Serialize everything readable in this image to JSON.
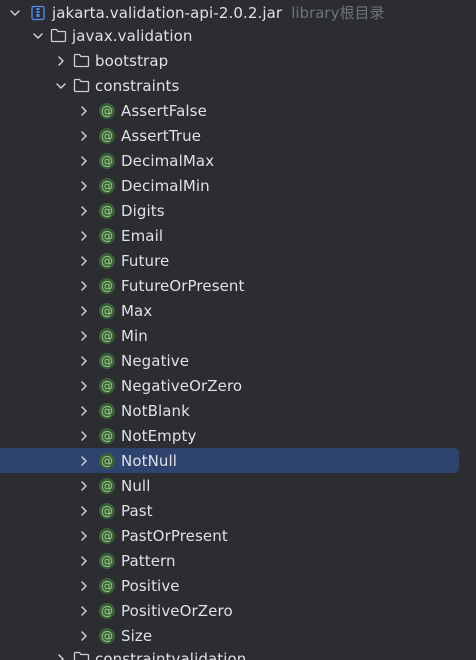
{
  "tree": {
    "jar": {
      "label": "jakarta.validation-api-2.0.2.jar",
      "hint": "library根目录",
      "icon": "jar-archive-icon"
    },
    "packages": {
      "javax_validation": "javax.validation",
      "bootstrap": "bootstrap",
      "constraints": "constraints",
      "constraintvalidation": "constraintvalidation"
    },
    "annotation_glyph": "@",
    "annotation_color": "#9fd08d",
    "selection_color": "#2e436e",
    "annotations": [
      "AssertFalse",
      "AssertTrue",
      "DecimalMax",
      "DecimalMin",
      "Digits",
      "Email",
      "Future",
      "FutureOrPresent",
      "Max",
      "Min",
      "Negative",
      "NegativeOrZero",
      "NotBlank",
      "NotEmpty",
      "NotNull",
      "Null",
      "Past",
      "PastOrPresent",
      "Pattern",
      "Positive",
      "PositiveOrZero",
      "Size"
    ],
    "selected": "NotNull"
  }
}
